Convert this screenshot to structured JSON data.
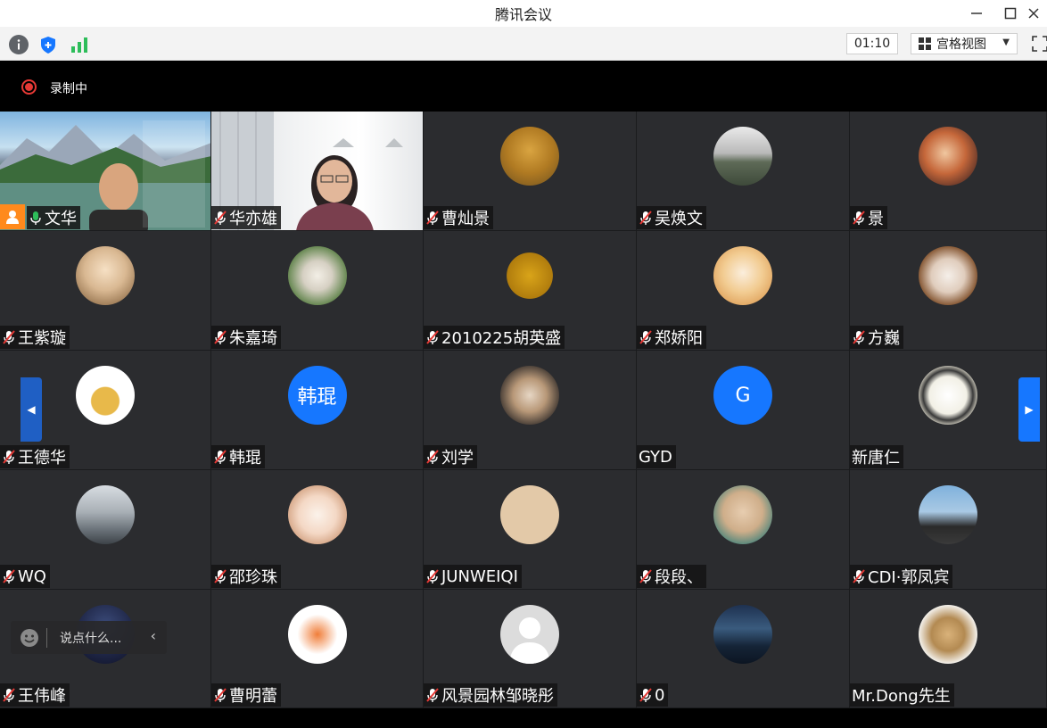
{
  "window": {
    "title": "腾讯会议",
    "buttons": [
      "minimize-icon",
      "maximize-icon",
      "close-icon"
    ]
  },
  "toolbar": {
    "icons": [
      "info-icon",
      "shield-icon",
      "signal-icon"
    ],
    "timer": "01:10",
    "view_label": "宫格视图",
    "fullscreen_icon": "fullscreen-icon"
  },
  "recording": {
    "label": "录制中",
    "color": "#e53935"
  },
  "colors": {
    "tile_bg": "#2b2c2f",
    "accent_blue": "#1677ff",
    "host_orange": "#ff8a1c",
    "mic_muted": "#e53935"
  },
  "participants": [
    {
      "name": "文华",
      "mic": "on",
      "host": true,
      "kind": "video"
    },
    {
      "name": "华亦雄",
      "mic": "off",
      "kind": "video"
    },
    {
      "name": "曹灿景",
      "mic": "off",
      "kind": "photo"
    },
    {
      "name": "吴焕文",
      "mic": "off",
      "kind": "photo"
    },
    {
      "name": "景",
      "mic": "off",
      "kind": "photo"
    },
    {
      "name": "王紫璇",
      "mic": "off",
      "kind": "photo"
    },
    {
      "name": "朱嘉琦",
      "mic": "off",
      "kind": "photo"
    },
    {
      "name": "2010225胡英盛",
      "mic": "off",
      "kind": "photo"
    },
    {
      "name": "郑娇阳",
      "mic": "off",
      "kind": "photo"
    },
    {
      "name": "方巍",
      "mic": "off",
      "kind": "photo"
    },
    {
      "name": "王德华",
      "mic": "off",
      "kind": "photo"
    },
    {
      "name": "韩琨",
      "mic": "off",
      "kind": "letters",
      "avatar_text": "韩琨"
    },
    {
      "name": "刘学",
      "mic": "off",
      "kind": "photo"
    },
    {
      "name": "GYD",
      "mic": "none",
      "kind": "letters",
      "avatar_text": "G"
    },
    {
      "name": "新唐仁",
      "mic": "none",
      "kind": "photo"
    },
    {
      "name": "WQ",
      "mic": "off",
      "kind": "photo"
    },
    {
      "name": "邵珍珠",
      "mic": "off",
      "kind": "photo"
    },
    {
      "name": "JUNWEIQI",
      "mic": "off",
      "kind": "photo"
    },
    {
      "name": "段段、",
      "mic": "off",
      "kind": "photo"
    },
    {
      "name": "CDI·郭凤宾",
      "mic": "off",
      "kind": "photo"
    },
    {
      "name": "王伟峰",
      "mic": "off",
      "kind": "photo"
    },
    {
      "name": "曹明蕾",
      "mic": "off",
      "kind": "photo"
    },
    {
      "name": "风景园林邹晓彤",
      "mic": "off",
      "kind": "photo"
    },
    {
      "name": "0",
      "mic": "off",
      "kind": "photo"
    },
    {
      "name": "Mr.Dong先生",
      "mic": "none",
      "kind": "photo"
    }
  ],
  "chat": {
    "placeholder": "说点什么..."
  }
}
